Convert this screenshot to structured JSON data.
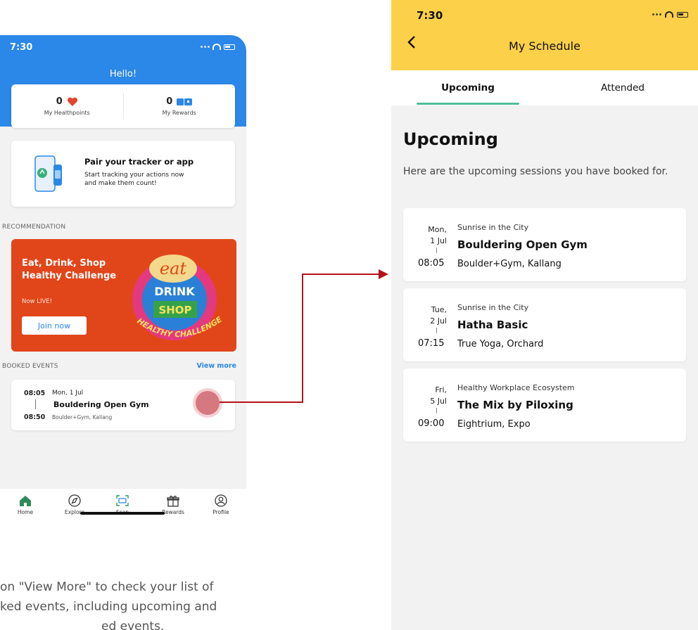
{
  "left_phone": {
    "status_time": "7:30",
    "greeting": "Hello!",
    "healthpoints": {
      "value": "0",
      "label": "My Healthpoints"
    },
    "rewards": {
      "value": "0",
      "label": "My Rewards"
    },
    "pair_card": {
      "title": "Pair your tracker or app",
      "line1": "Start tracking your actions now",
      "line2": "and make them count!"
    },
    "recommendation_label": "RECOMMENDATION",
    "promo": {
      "title": "Eat, Drink, Shop Healthy Challenge",
      "subtitle": "Now LIVE!",
      "button": "Join now",
      "art_text_1": "eat",
      "art_text_2": "DRINK",
      "art_text_3": "SHOP",
      "art_banner": "HEALTHY CHALLENGE"
    },
    "booked_events_label": "BOOKED EVENTS",
    "view_more": "View more",
    "booked_event": {
      "start": "08:05",
      "date": "Mon, 1 Jul",
      "name": "Bouldering Open Gym",
      "end": "08:50",
      "location": "Boulder+Gym, Kallang"
    },
    "tabs": [
      {
        "label": "Home",
        "icon": "home-icon"
      },
      {
        "label": "Explore",
        "icon": "compass-icon"
      },
      {
        "label": "Scan",
        "icon": "scan-icon"
      },
      {
        "label": "Rewards",
        "icon": "gift-icon"
      },
      {
        "label": "Profile",
        "icon": "profile-icon"
      }
    ]
  },
  "caption": {
    "line1": "on \"View More\" to check your list of",
    "line2": "ked events, including upcoming and",
    "line3": "ed events."
  },
  "right_phone": {
    "status_time": "7:30",
    "title": "My Schedule",
    "tabs": [
      {
        "label": "Upcoming",
        "active": true
      },
      {
        "label": "Attended",
        "active": false
      }
    ],
    "heading": "Upcoming",
    "intro": "Here are the upcoming sessions you have booked for.",
    "sessions": [
      {
        "day": "Mon,",
        "date": "1 Jul",
        "time": "08:05",
        "organizer": "Sunrise in the City",
        "name": "Bouldering Open Gym",
        "location": "Boulder+Gym, Kallang"
      },
      {
        "day": "Tue,",
        "date": "2 Jul",
        "time": "07:15",
        "organizer": "Sunrise in the City",
        "name": "Hatha Basic",
        "location": "True Yoga, Orchard"
      },
      {
        "day": "Fri,",
        "date": "5 Jul",
        "time": "09:00",
        "organizer": "Healthy Workplace Ecosystem",
        "name": "The Mix by Piloxing",
        "location": "Eightrium, Expo"
      }
    ]
  },
  "colors": {
    "left_header": "#2b87e8",
    "right_header": "#fdd04a",
    "promo_bg": "#e1461a",
    "tab_underline": "#4fbe96",
    "connector": "#b5121b",
    "home_active": "#2e8b57"
  }
}
